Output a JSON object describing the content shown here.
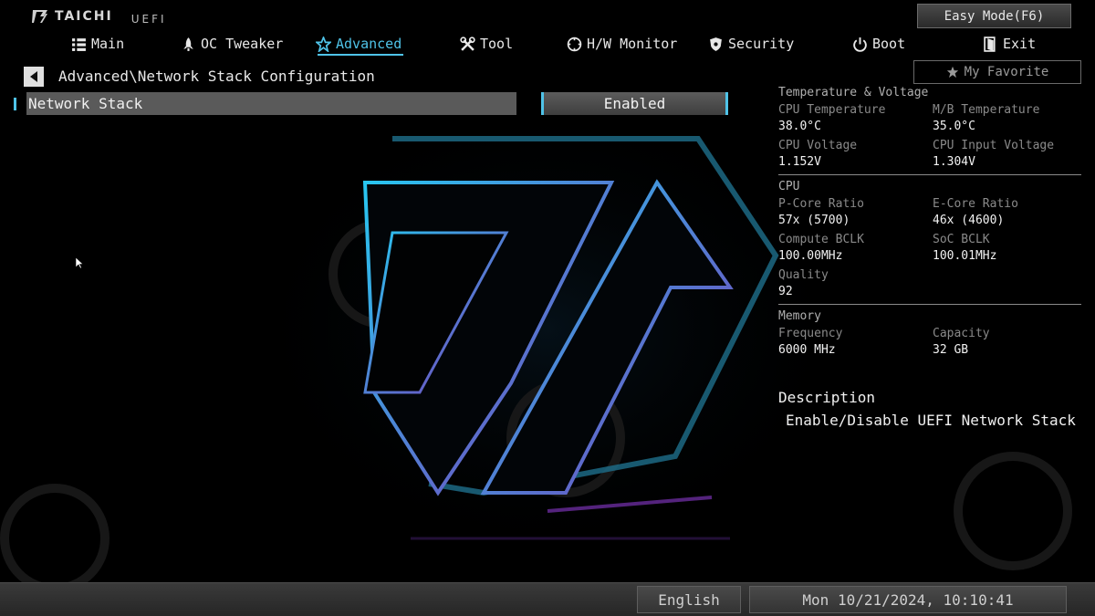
{
  "brand": {
    "name": "TAICHI",
    "sub": "UEFI",
    "logo_icon": "asrock-logo-icon"
  },
  "easy_mode_label": "Easy Mode(F6)",
  "nav": [
    {
      "label": "Main",
      "icon": "list-icon",
      "active": false
    },
    {
      "label": "OC Tweaker",
      "icon": "rocket-icon",
      "active": false
    },
    {
      "label": "Advanced",
      "icon": "star-icon",
      "active": true
    },
    {
      "label": "Tool",
      "icon": "tools-icon",
      "active": false
    },
    {
      "label": "H/W Monitor",
      "icon": "monitor-icon",
      "active": false
    },
    {
      "label": "Security",
      "icon": "shield-icon",
      "active": false
    },
    {
      "label": "Boot",
      "icon": "power-icon",
      "active": false
    },
    {
      "label": "Exit",
      "icon": "exit-icon",
      "active": false
    }
  ],
  "breadcrumb": "Advanced\\Network Stack Configuration",
  "favorite_label": "My Favorite",
  "setting": {
    "label": "Network Stack",
    "value": "Enabled"
  },
  "info": {
    "temp_voltage": {
      "title": "Temperature & Voltage",
      "cpu_temp_label": "CPU Temperature",
      "cpu_temp_value": "38.0°C",
      "mb_temp_label": "M/B Temperature",
      "mb_temp_value": "35.0°C",
      "cpu_voltage_label": "CPU Voltage",
      "cpu_voltage_value": "1.152V",
      "cpu_input_voltage_label": "CPU Input Voltage",
      "cpu_input_voltage_value": "1.304V"
    },
    "cpu": {
      "title": "CPU",
      "pcore_label": "P-Core Ratio",
      "pcore_value": "57x (5700)",
      "ecore_label": "E-Core Ratio",
      "ecore_value": "46x (4600)",
      "compute_bclk_label": "Compute BCLK",
      "compute_bclk_value": "100.00MHz",
      "soc_bclk_label": "SoC BCLK",
      "soc_bclk_value": "100.01MHz",
      "quality_label": "Quality",
      "quality_value": "92"
    },
    "memory": {
      "title": "Memory",
      "frequency_label": "Frequency",
      "frequency_value": "6000 MHz",
      "capacity_label": "Capacity",
      "capacity_value": "32 GB"
    }
  },
  "description": {
    "title": "Description",
    "text": "Enable/Disable UEFI Network Stack"
  },
  "footer": {
    "language": "English",
    "datetime": "Mon 10/21/2024, 10:10:41"
  },
  "colors": {
    "accent": "#4fc3e8",
    "background": "#000000",
    "highlight_row": "#5a5a5a"
  }
}
